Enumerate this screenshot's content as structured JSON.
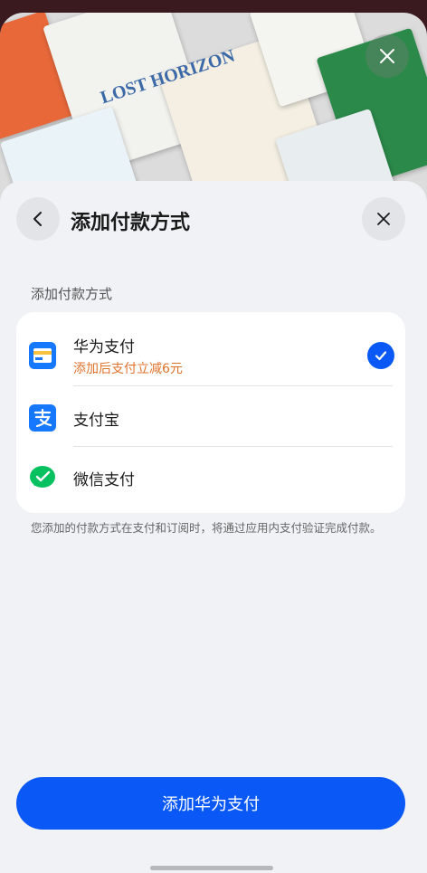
{
  "background": {
    "book_cover_text": "LOST HORIZON"
  },
  "header": {
    "title": "添加付款方式"
  },
  "section_label": "添加付款方式",
  "payment_methods": [
    {
      "name": "华为支付",
      "promo": "添加后支付立减6元",
      "selected": true,
      "icon": "huawei-pay-icon"
    },
    {
      "name": "支付宝",
      "promo": "",
      "selected": false,
      "icon": "alipay-icon"
    },
    {
      "name": "微信支付",
      "promo": "",
      "selected": false,
      "icon": "wechat-pay-icon"
    }
  ],
  "note": "您添加的付款方式在支付和订阅时，将通过应用内支付验证完成付款。",
  "cta_label": "添加华为支付",
  "colors": {
    "accent": "#0a59f7",
    "promo": "#e0722c",
    "alipay": "#1677ff",
    "wechat": "#07c160"
  }
}
